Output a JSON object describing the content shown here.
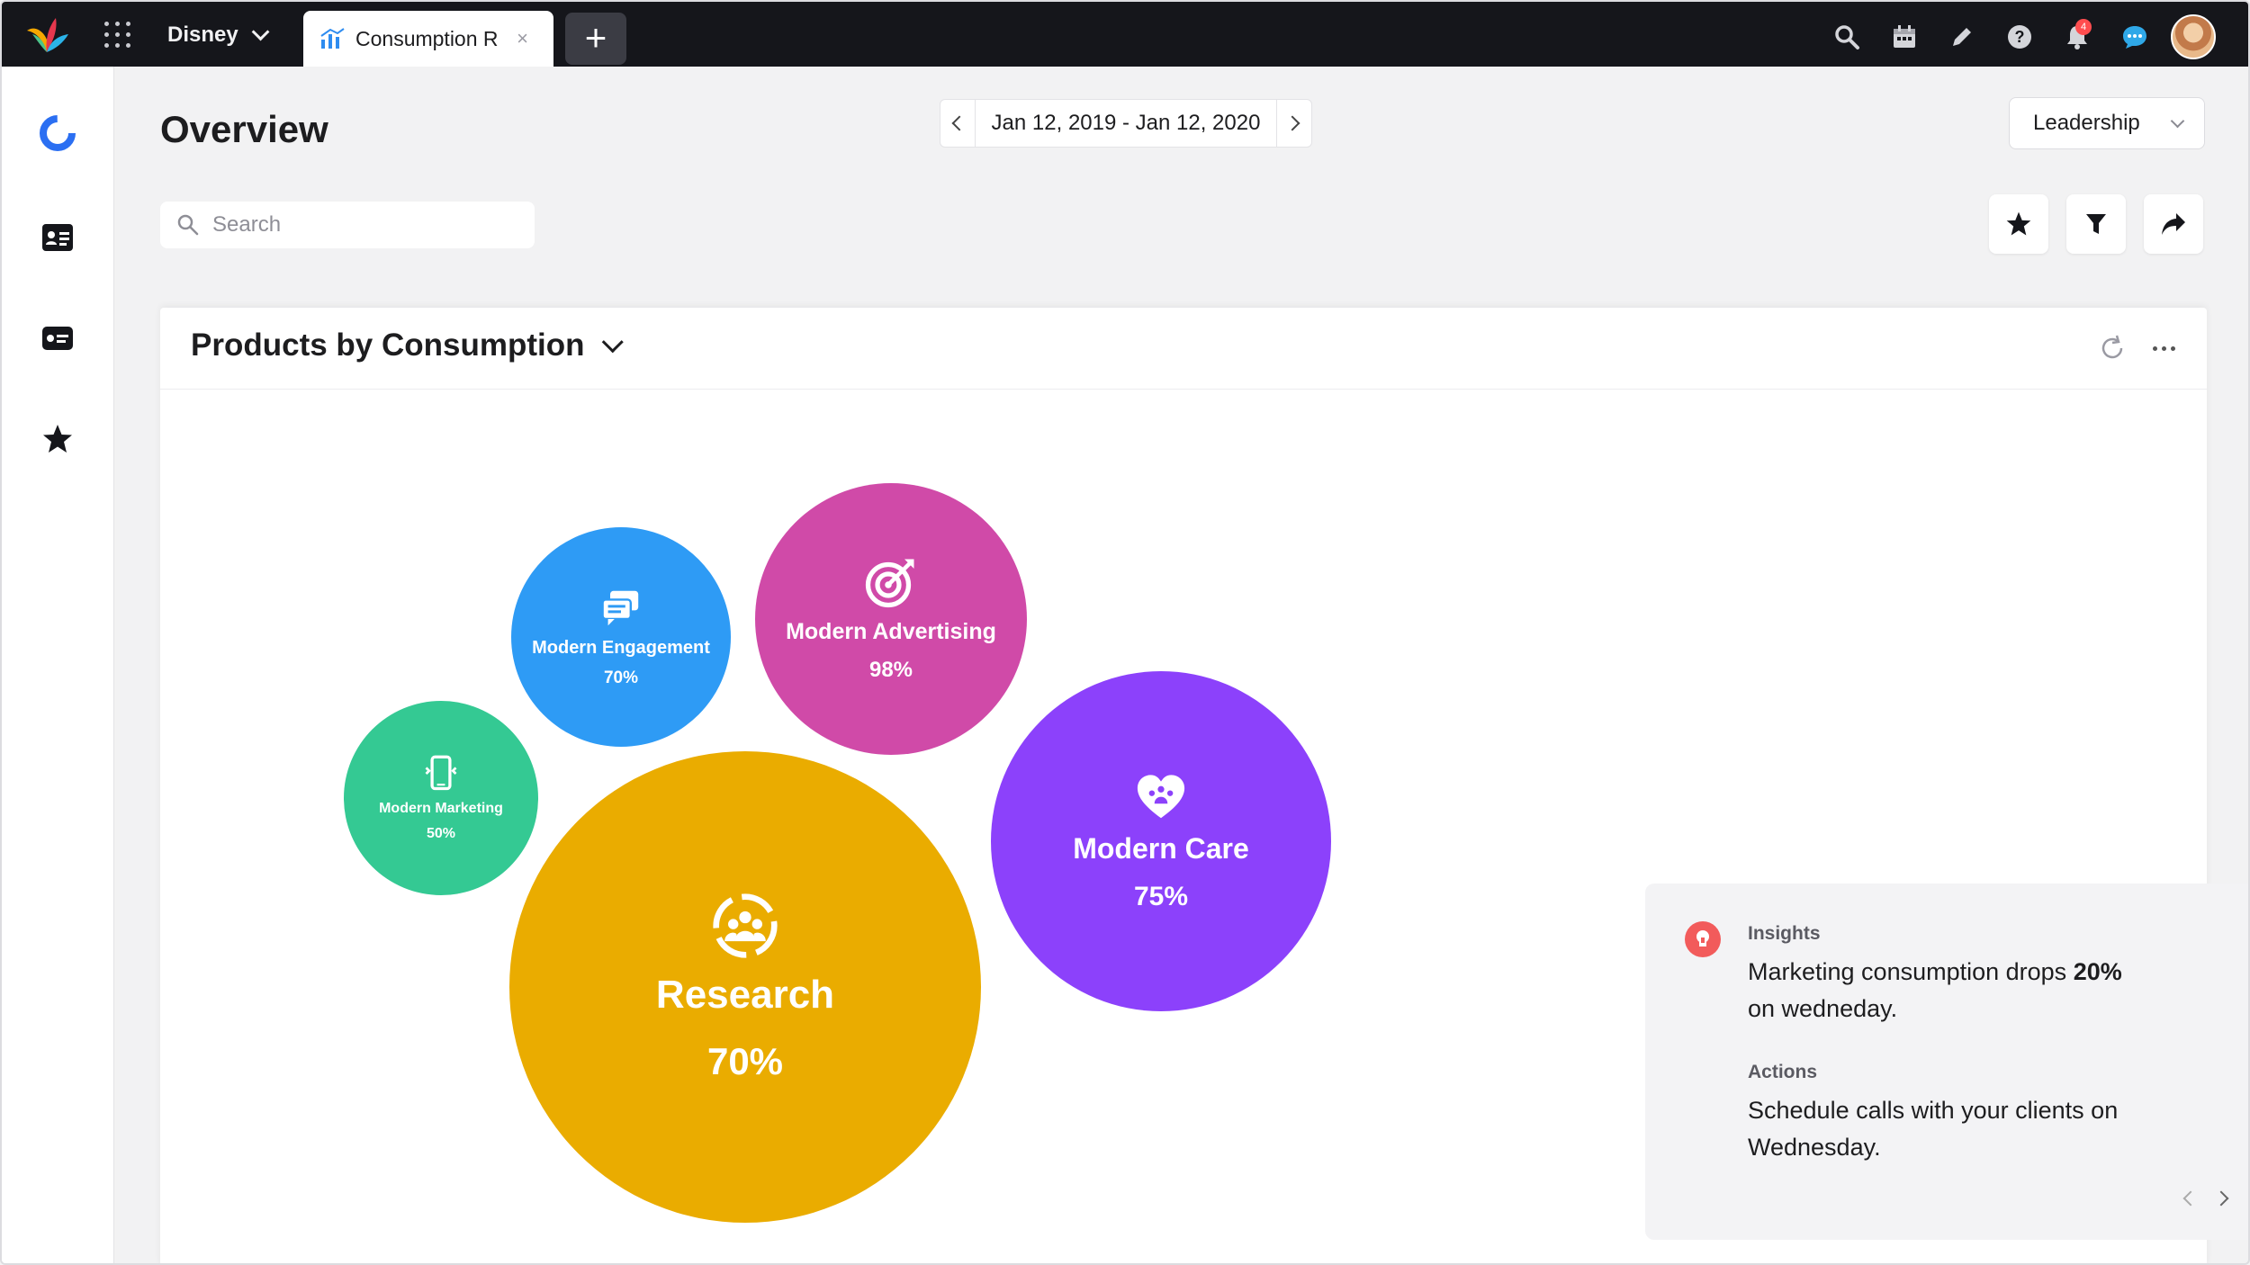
{
  "topbar": {
    "workspace": "Disney",
    "tab_label": "Consumption R",
    "tab_close": "×",
    "new_tab": "+",
    "notification_count": "4",
    "icons": [
      "search-icon",
      "calendar-icon",
      "pencil-icon",
      "help-icon",
      "bell-icon",
      "chat-icon"
    ]
  },
  "sidebar": {
    "items": [
      "reports-icon",
      "contact-card-icon",
      "id-card-icon",
      "star-icon"
    ]
  },
  "header": {
    "title": "Overview",
    "date_range": "Jan 12, 2019 - Jan 12, 2020",
    "view_select": "Leadership",
    "search_placeholder": "Search"
  },
  "card": {
    "title": "Products by Consumption"
  },
  "chart_data": {
    "type": "bubble",
    "title": "Products by Consumption",
    "series": [
      {
        "name": "Modern Engagement",
        "value_label": "70%",
        "value": 70,
        "color": "#2e9bf5",
        "icon": "chat-icon"
      },
      {
        "name": "Modern Advertising",
        "value_label": "98%",
        "value": 98,
        "color": "#d04aa8",
        "icon": "target-icon"
      },
      {
        "name": "Modern Marketing",
        "value_label": "50%",
        "value": 50,
        "color": "#34c993",
        "icon": "mobile-icon"
      },
      {
        "name": "Research",
        "value_label": "70%",
        "value": 70,
        "color": "#eaac00",
        "icon": "people-icon"
      },
      {
        "name": "Modern Care",
        "value_label": "75%",
        "value": 75,
        "color": "#8c41fb",
        "icon": "heart-icon"
      }
    ]
  },
  "insights": {
    "label": "Insights",
    "text_before": "Marketing consumption drops ",
    "text_bold": "20%",
    "text_after": "on wedneday.",
    "actions_label": "Actions",
    "actions_text": "Schedule calls with your clients on Wednesday.",
    "accent": "#f25b5b"
  }
}
